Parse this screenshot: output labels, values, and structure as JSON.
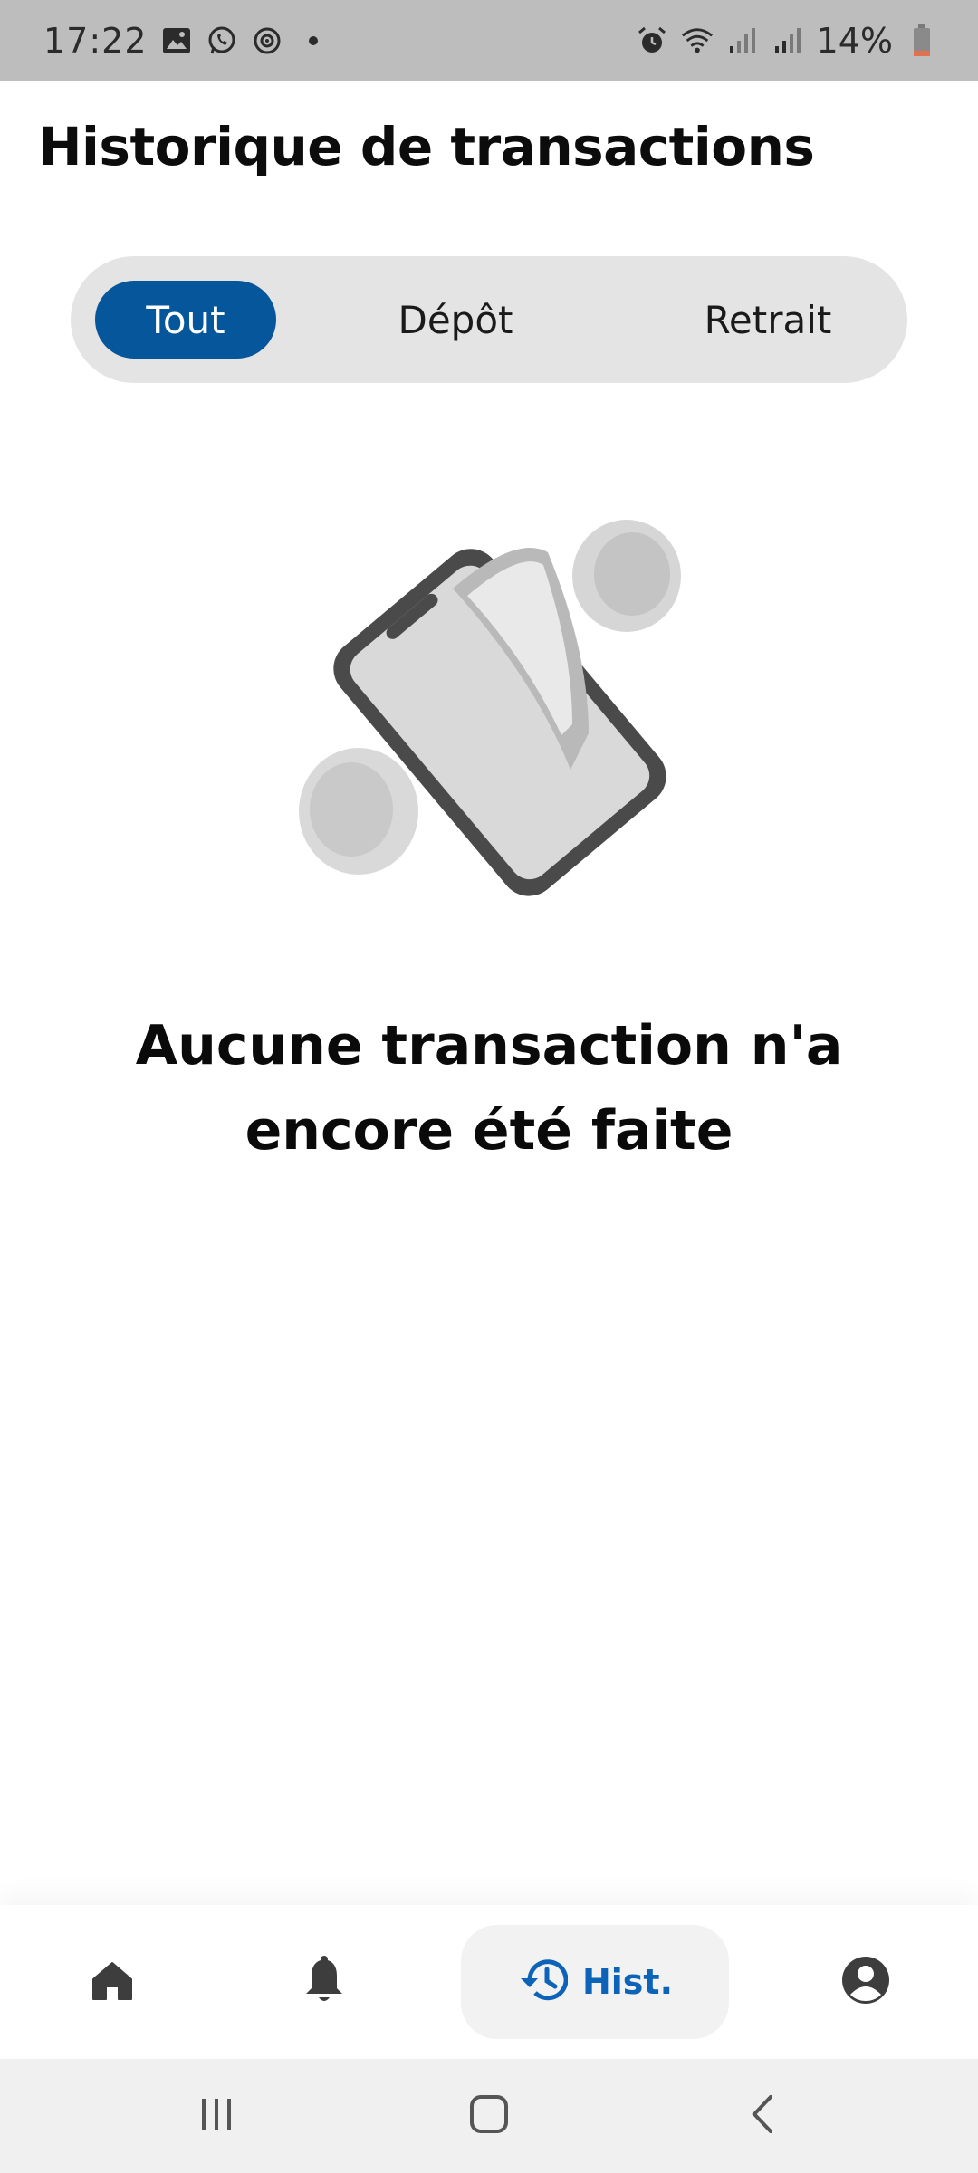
{
  "status_bar": {
    "time": "17:22",
    "battery": "14%",
    "left_icons": [
      "gallery-icon",
      "whatsapp-icon",
      "sync-icon"
    ],
    "right_icons": [
      "alarm-icon",
      "wifi-icon",
      "signal-icon",
      "signal-icon",
      "battery-icon"
    ]
  },
  "header": {
    "title": "Historique de transactions"
  },
  "filters": {
    "selected": "Tout",
    "tabs": [
      {
        "label": "Tout"
      },
      {
        "label": "Dépôt"
      },
      {
        "label": "Retrait"
      }
    ]
  },
  "empty_state": {
    "illustration": "phone-with-coins-illustration",
    "line1": "Aucune transaction n'a",
    "line2": "encore été faite"
  },
  "bottom_nav": {
    "active": "Hist.",
    "items": [
      {
        "icon": "home-icon"
      },
      {
        "icon": "bell-icon"
      },
      {
        "icon": "history-icon",
        "label": "Hist."
      },
      {
        "icon": "account-icon"
      }
    ]
  },
  "colors": {
    "accent": "#06569c",
    "active_nav": "#0d63b8",
    "segment_bg": "#e4e4e4",
    "status_bar": "#bdbdbd"
  }
}
